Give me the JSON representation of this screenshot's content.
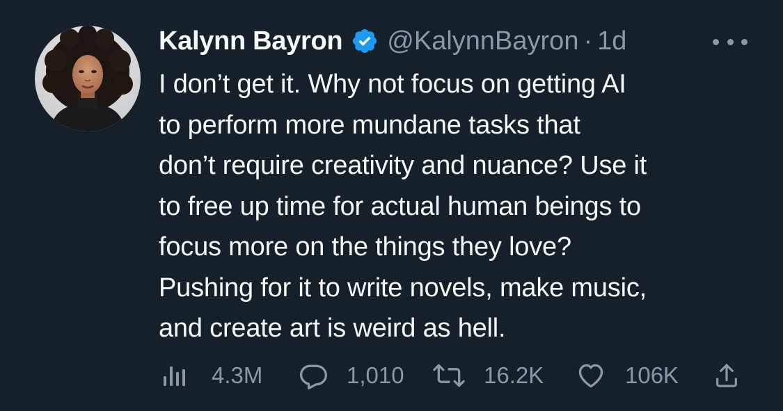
{
  "tweet": {
    "author": {
      "name": "Kalynn Bayron",
      "handle": "@KalynnBayron",
      "verified": true
    },
    "separator": "·",
    "time": "1d",
    "text_lines": [
      "I don’t get it. Why not focus on getting AI",
      "to perform more mundane tasks that",
      "don’t require creativity and nuance? Use it",
      "to free up time for actual human beings to",
      "focus more on the things they love?",
      "Pushing for it to write novels, make music,",
      "and create art is weird as hell."
    ],
    "stats": {
      "views": "4.3M",
      "replies": "1,010",
      "retweets": "16.2K",
      "likes": "106K"
    }
  },
  "colors": {
    "background": "#15202b",
    "primary_text": "#f7f9f9",
    "secondary_text": "#8b98a5",
    "verified_badge": "#1d9bf0"
  },
  "icons": {
    "verified": "verified-badge-icon",
    "more": "more-options-icon",
    "views": "views-bar-chart-icon",
    "reply": "reply-bubble-icon",
    "retweet": "retweet-arrows-icon",
    "like": "heart-icon",
    "share": "share-upload-icon"
  }
}
